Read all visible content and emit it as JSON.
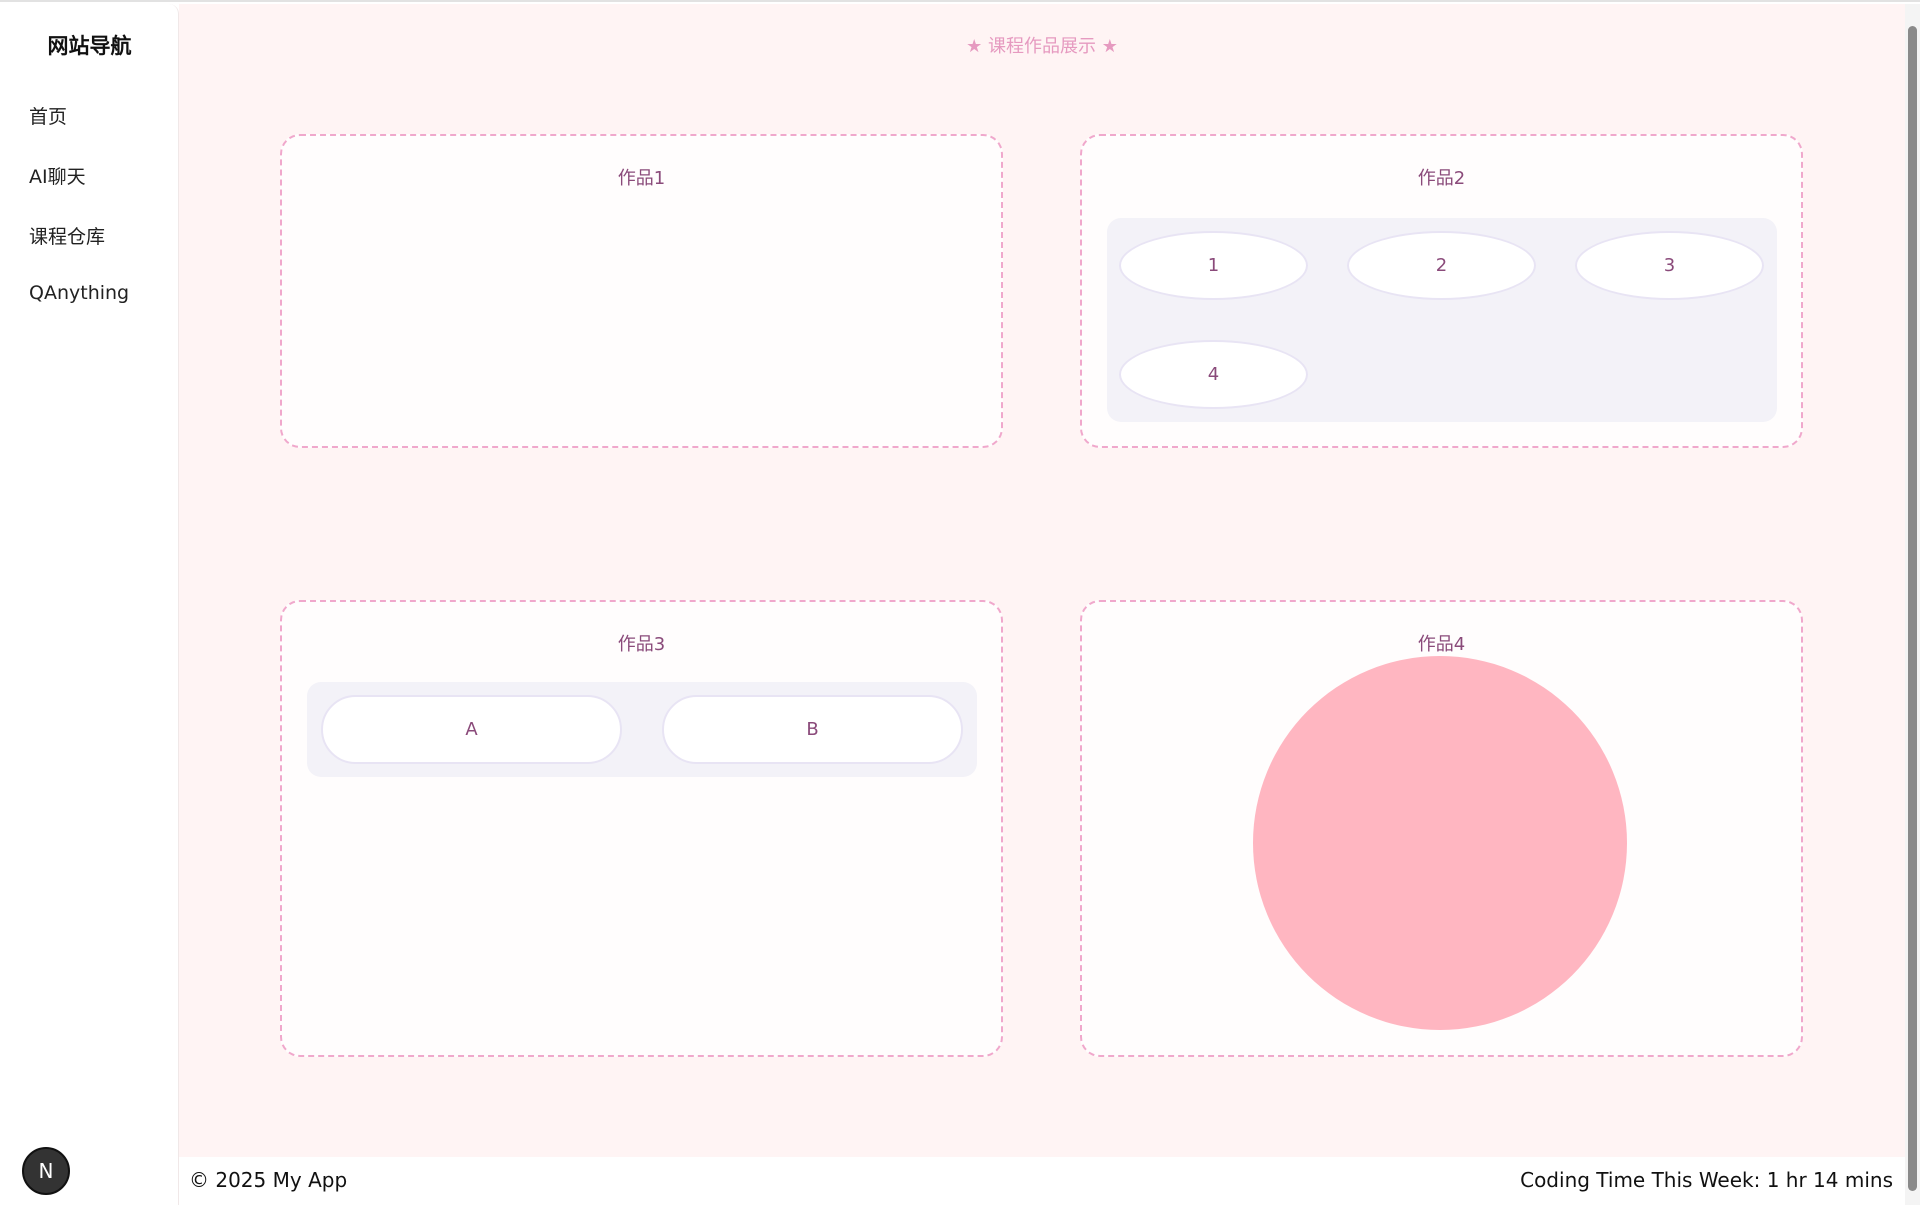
{
  "sidebar": {
    "title": "网站导航",
    "items": [
      {
        "label": "首页"
      },
      {
        "label": "AI聊天"
      },
      {
        "label": "课程仓库"
      },
      {
        "label": "QAnything"
      }
    ],
    "avatar": "N"
  },
  "main": {
    "header": "★ 课程作品展示 ★",
    "cards": [
      {
        "title": "作品1"
      },
      {
        "title": "作品2",
        "items": [
          "1",
          "2",
          "3",
          "4"
        ]
      },
      {
        "title": "作品3",
        "items": [
          "A",
          "B"
        ]
      },
      {
        "title": "作品4",
        "circle_color": "#ffb6c1"
      }
    ]
  },
  "footer": {
    "copyright": "© 2025 My App",
    "coding_time": "Coding Time This Week: 1 hr 14 mins"
  }
}
